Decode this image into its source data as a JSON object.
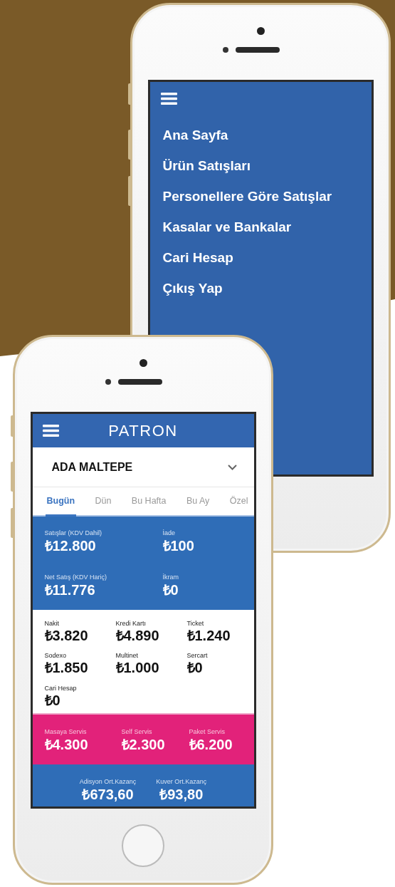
{
  "menu_screen": {
    "items": [
      {
        "label": "Ana Sayfa"
      },
      {
        "label": "Ürün Satışları"
      },
      {
        "label": "Personellere Göre Satışlar"
      },
      {
        "label": "Kasalar ve Bankalar"
      },
      {
        "label": "Cari Hesap"
      },
      {
        "label": "Çıkış Yap"
      }
    ]
  },
  "dashboard": {
    "title": "PATRON",
    "branch": "ADA MALTEPE",
    "tabs": [
      {
        "label": "Bugün",
        "selected": true
      },
      {
        "label": "Dün",
        "selected": false
      },
      {
        "label": "Bu Hafta",
        "selected": false
      },
      {
        "label": "Bu Ay",
        "selected": false
      },
      {
        "label": "Özel",
        "selected": false
      }
    ],
    "summary": [
      {
        "label": "Satışlar (KDV Dahil)",
        "value": "₺12.800"
      },
      {
        "label": "İade",
        "value": "₺100"
      },
      {
        "label": "Net Satış (KDV Hariç)",
        "value": "₺11.776"
      },
      {
        "label": "İkram",
        "value": "₺0"
      }
    ],
    "payments": [
      {
        "label": "Nakit",
        "value": "₺3.820"
      },
      {
        "label": "Kredi Kartı",
        "value": "₺4.890"
      },
      {
        "label": "Ticket",
        "value": "₺1.240"
      },
      {
        "label": "Sodexo",
        "value": "₺1.850"
      },
      {
        "label": "Multinet",
        "value": "₺1.000"
      },
      {
        "label": "Sercart",
        "value": "₺0"
      },
      {
        "label": "Cari Hesap",
        "value": "₺0"
      }
    ],
    "services": [
      {
        "label": "Masaya Servis",
        "value": "₺4.300"
      },
      {
        "label": "Self Servis",
        "value": "₺2.300"
      },
      {
        "label": "Paket Servis",
        "value": "₺6.200"
      }
    ],
    "averages": [
      {
        "label": "Adisyon Ort.Kazanç",
        "value": "₺673,60"
      },
      {
        "label": "Kuver Ort.Kazanç",
        "value": "₺93,80"
      }
    ]
  }
}
